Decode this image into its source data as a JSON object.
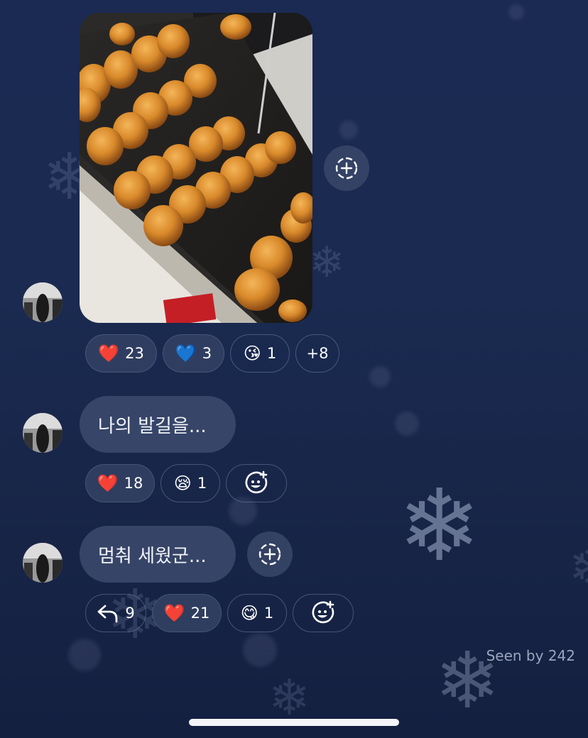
{
  "messages": [
    {
      "type": "photo",
      "reactions": [
        {
          "emoji": "❤️",
          "count": "23"
        },
        {
          "emoji": "💙",
          "count": "3"
        },
        {
          "emoji": "😘",
          "count": "1"
        },
        {
          "label": "+8"
        }
      ]
    },
    {
      "type": "text",
      "text": "나의 발길을...",
      "reactions": [
        {
          "emoji": "❤️",
          "count": "18"
        },
        {
          "emoji": "😪",
          "count": "1"
        }
      ]
    },
    {
      "type": "text",
      "text": "멈춰 세웠군...",
      "reactions": [
        {
          "reply_count": "9"
        },
        {
          "emoji": "❤️",
          "count": "21"
        },
        {
          "emoji": "😋",
          "count": "1"
        }
      ]
    }
  ],
  "seen_text": "Seen by 242",
  "icons": {
    "add_reaction": "add-reaction-icon",
    "reply": "reply-arrow-icon",
    "emoji_add": "emoji-add-icon"
  },
  "colors": {
    "background": "#1a2a50",
    "bubble": "#3a486a",
    "pill": "#344264",
    "accent_red": "#e0243a",
    "accent_blue": "#2f7de1"
  }
}
